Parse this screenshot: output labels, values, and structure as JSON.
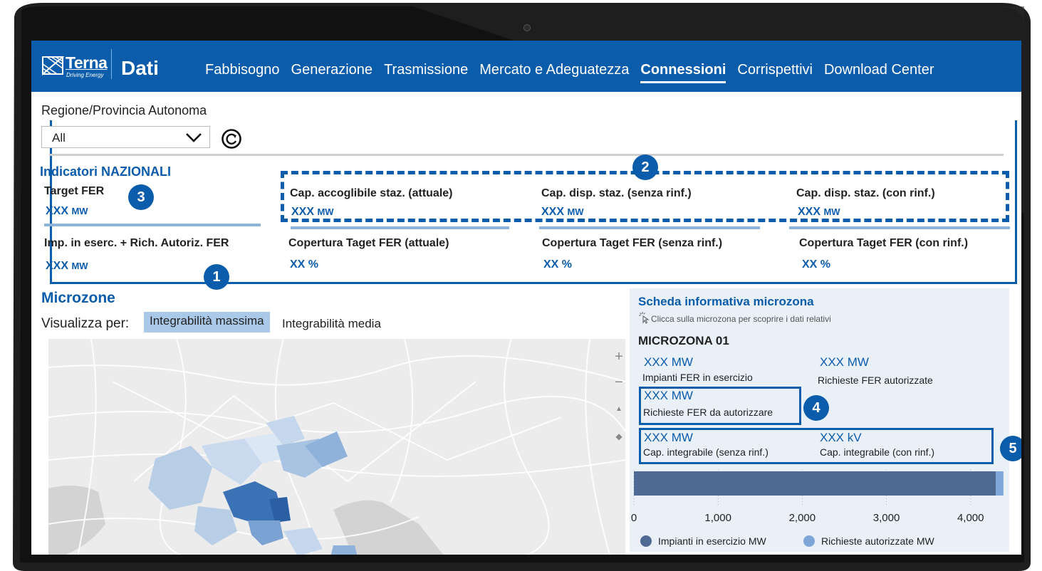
{
  "nav": {
    "logo_word": "Terna",
    "logo_tagline": "Driving Energy",
    "app_title": "Dati",
    "items": [
      "Fabbisogno",
      "Generazione",
      "Trasmissione",
      "Mercato e Adeguatezza",
      "Connessioni",
      "Corrispettivi",
      "Download Center"
    ],
    "active": "Connessioni"
  },
  "filter": {
    "label": "Regione/Provincia Autonoma",
    "selected": "All"
  },
  "indicators": {
    "title": "Indicatori NAZIONALI",
    "row1": [
      {
        "label": "Target FER",
        "value": "XXX",
        "unit": "MW"
      },
      {
        "label": "Cap. accoglibile staz. (attuale)",
        "value": "XXX",
        "unit": "MW"
      },
      {
        "label": "Cap. disp. staz. (senza rinf.)",
        "value": "XXX",
        "unit": "MW"
      },
      {
        "label": "Cap. disp. staz. (con rinf.)",
        "value": "XXX",
        "unit": "MW"
      }
    ],
    "row2": [
      {
        "label": "Imp. in eserc. + Rich. Autoriz. FER",
        "value": "XXX",
        "unit": "MW"
      },
      {
        "label": "Copertura Taget FER (attuale)",
        "value": "XX %",
        "unit": ""
      },
      {
        "label": "Copertura Taget FER (senza rinf.)",
        "value": "XX %",
        "unit": ""
      },
      {
        "label": "Copertura Taget FER (con rinf.)",
        "value": "XX %",
        "unit": ""
      }
    ]
  },
  "badges": {
    "b1": "1",
    "b2": "2",
    "b3": "3",
    "b4": "4",
    "b5": "5"
  },
  "microzone": {
    "title": "Microzone",
    "view_label": "Visualizza per:",
    "options": [
      "Integrabilità massima",
      "Integrabilità media"
    ],
    "selected": "Integrabilità massima",
    "map_controls": [
      "+",
      "−",
      "▲",
      "◆"
    ]
  },
  "info_panel": {
    "title": "Scheda informativa microzona",
    "hint": "Clicca sulla microzona per scoprire i dati relativi",
    "zone_name": "MICROZONA 01",
    "fields": [
      {
        "value": "XXX MW",
        "label": "Impianti FER in esercizio"
      },
      {
        "value": "XXX MW",
        "label": "Richieste FER autorizzate"
      },
      {
        "value": "XXX MW",
        "label": "Richieste FER da autorizzare"
      },
      {
        "value": "XXX MW",
        "label": "Cap. integrabile (senza rinf.)"
      },
      {
        "value": "XXX kV",
        "label": "Cap. integrabile (con rinf.)"
      }
    ]
  },
  "colors": {
    "brand": "#0b5cab",
    "series_esercizio": "#4f6a92",
    "series_autorizzate": "#7ea6d8"
  },
  "chart_data": {
    "type": "bar",
    "orientation": "horizontal",
    "stacked": true,
    "categories": [
      ""
    ],
    "series": [
      {
        "name": "Impianti in esercizio MW",
        "values": [
          4300
        ]
      },
      {
        "name": "Richieste autorizzate MW",
        "values": [
          90
        ]
      }
    ],
    "xticks": [
      "0",
      "1,000",
      "2,000",
      "3,000",
      "4,000"
    ],
    "xlim": [
      0,
      4400
    ],
    "grid": true,
    "legend": "bottom"
  }
}
